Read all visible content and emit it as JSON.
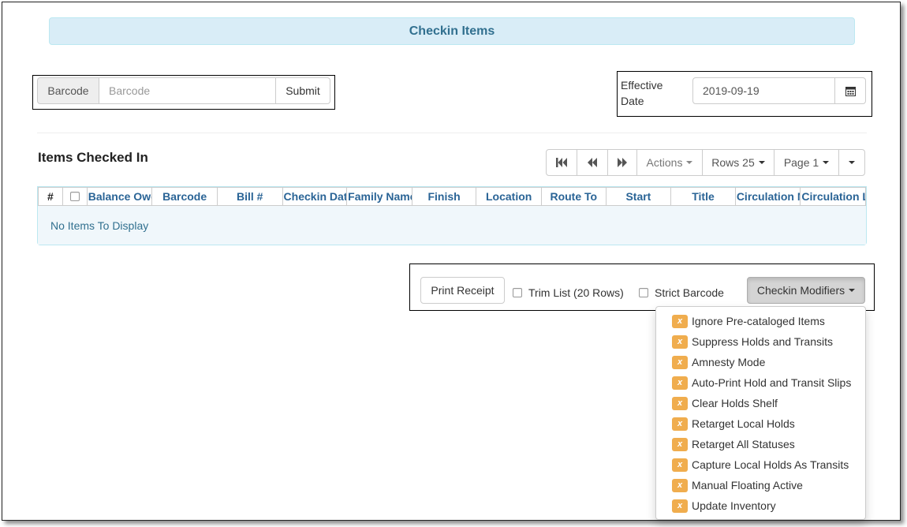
{
  "title": "Checkin Items",
  "barcode": {
    "addon_label": "Barcode",
    "placeholder": "Barcode",
    "value": "",
    "submit_label": "Submit"
  },
  "effective_date": {
    "label": "Effective Date",
    "value": "2019-09-19",
    "icon": "calendar-icon"
  },
  "grid": {
    "title": "Items Checked In",
    "pager": {
      "first_icon": "first-page-icon",
      "prev_icon": "prev-page-icon",
      "next_icon": "next-page-icon",
      "actions_label": "Actions",
      "rows_label": "Rows 25",
      "page_label": "Page 1"
    },
    "columns": [
      "#",
      "Balance Owed",
      "Barcode",
      "Bill #",
      "Checkin Date",
      "Family Name",
      "Finish",
      "Location",
      "Route To",
      "Start",
      "Title",
      "Circulation Modifier",
      "Circulation Library"
    ],
    "empty_message": "No Items To Display"
  },
  "footer": {
    "print_label": "Print Receipt",
    "trim_label": "Trim List (20 Rows)",
    "strict_label": "Strict Barcode",
    "modifiers_label": "Checkin Modifiers"
  },
  "modifiers_menu": {
    "badge": "x",
    "badge_color": "#f0ad4e",
    "items": [
      "Ignore Pre-cataloged Items",
      "Suppress Holds and Transits",
      "Amnesty Mode",
      "Auto-Print Hold and Transit Slips",
      "Clear Holds Shelf",
      "Retarget Local Holds",
      "Retarget All Statuses",
      "Capture Local Holds As Transits",
      "Manual Floating Active",
      "Update Inventory"
    ]
  },
  "colors": {
    "header_bg": "#d9edf7",
    "header_text": "#31708f",
    "column_text": "#2a6496"
  }
}
